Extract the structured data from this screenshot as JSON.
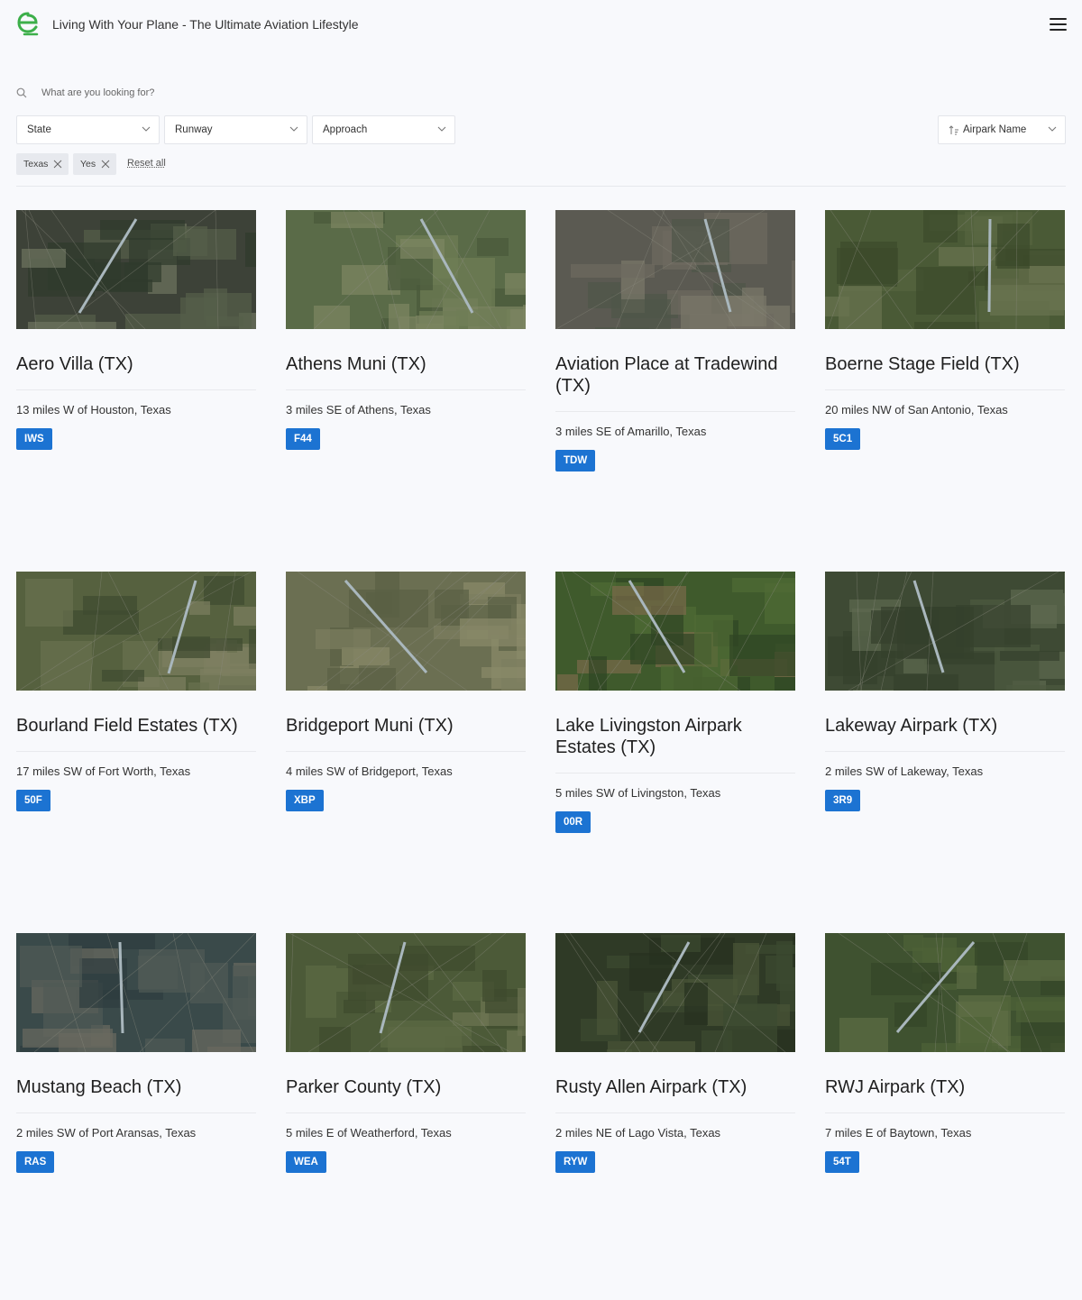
{
  "header": {
    "site_title": "Living With Your Plane - The Ultimate Aviation Lifestyle",
    "logo_icon": "logo-e-icon",
    "menu_icon": "hamburger-menu-icon",
    "brand_color": "#3daf4a"
  },
  "search": {
    "placeholder": "What are you looking for?",
    "value": ""
  },
  "filters": {
    "state_label": "State",
    "runway_label": "Runway",
    "approach_label": "Approach",
    "sort_label": "Airpark Name",
    "active_chips": [
      "Texas",
      "Yes"
    ],
    "reset_label": "Reset all"
  },
  "accent_color": "#1c73d2",
  "airparks": [
    {
      "name": "Aero Villa (TX)",
      "location": "13 miles W of Houston, Texas",
      "code": "IWS"
    },
    {
      "name": "Athens Muni (TX)",
      "location": "3 miles SE of Athens, Texas",
      "code": "F44"
    },
    {
      "name": "Aviation Place at Tradewind (TX)",
      "location": "3 miles SE of Amarillo, Texas",
      "code": "TDW"
    },
    {
      "name": "Boerne Stage Field (TX)",
      "location": "20 miles NW of San Antonio, Texas",
      "code": "5C1"
    },
    {
      "name": "Bourland Field Estates (TX)",
      "location": "17 miles SW of Fort Worth, Texas",
      "code": "50F"
    },
    {
      "name": "Bridgeport Muni (TX)",
      "location": "4 miles SW of Bridgeport, Texas",
      "code": "XBP"
    },
    {
      "name": "Lake Livingston Airpark Estates (TX)",
      "location": "5 miles SW of Livingston, Texas",
      "code": "00R"
    },
    {
      "name": "Lakeway Airpark (TX)",
      "location": "2 miles SW of Lakeway, Texas",
      "code": "3R9"
    },
    {
      "name": "Mustang Beach (TX)",
      "location": "2 miles SW of Port Aransas, Texas",
      "code": "RAS"
    },
    {
      "name": "Parker County (TX)",
      "location": "5 miles E of Weatherford, Texas",
      "code": "WEA"
    },
    {
      "name": "Rusty Allen Airpark (TX)",
      "location": "2 miles NE of Lago Vista, Texas",
      "code": "RYW"
    },
    {
      "name": "RWJ Airpark (TX)",
      "location": "7 miles E of Baytown, Texas",
      "code": "54T"
    }
  ]
}
